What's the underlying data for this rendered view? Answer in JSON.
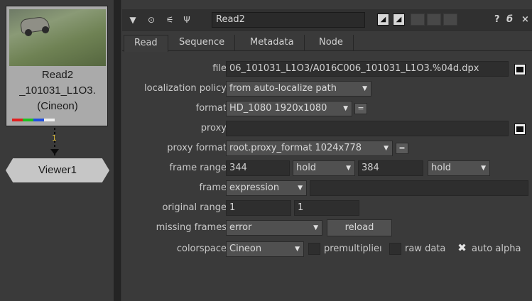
{
  "graph": {
    "read_node": {
      "name": "Read2",
      "file": "_101031_L1O3.",
      "colorspace": "(Cineon)"
    },
    "pipe_label": "1",
    "viewer_node": {
      "name": "Viewer1"
    },
    "channel_colors": [
      "#e02020",
      "#20c020",
      "#2050e0",
      "#f0f0f0"
    ]
  },
  "panel": {
    "titlebar": {
      "node_name": "Read2",
      "help": "?",
      "float": "б",
      "close": "×"
    },
    "tabs": [
      "Read",
      "Sequence",
      "Metadata",
      "Node"
    ],
    "active_tab": "Read",
    "fields": {
      "file": {
        "label": "file",
        "value": "06_101031_L1O3/A016C006_101031_L1O3.%04d.dpx"
      },
      "localization_policy": {
        "label": "localization policy",
        "value": "from auto-localize path"
      },
      "format": {
        "label": "format",
        "value": "HD_1080 1920x1080",
        "eq": "="
      },
      "proxy": {
        "label": "proxy",
        "value": ""
      },
      "proxy_format": {
        "label": "proxy format",
        "value": "root.proxy_format 1024x778",
        "eq": "="
      },
      "frame_range": {
        "label": "frame range",
        "first": "344",
        "before": "hold",
        "last": "384",
        "after": "hold"
      },
      "frame": {
        "label": "frame",
        "mode": "expression",
        "value": ""
      },
      "original_range": {
        "label": "original range",
        "first": "1",
        "last": "1"
      },
      "missing_frames": {
        "label": "missing frames",
        "value": "error",
        "reload": "reload"
      },
      "colorspace": {
        "label": "colorspace",
        "value": "Cineon",
        "premultiplied": "premultiplieı",
        "raw_data": "raw data",
        "auto_alpha": "auto alpha"
      }
    }
  }
}
